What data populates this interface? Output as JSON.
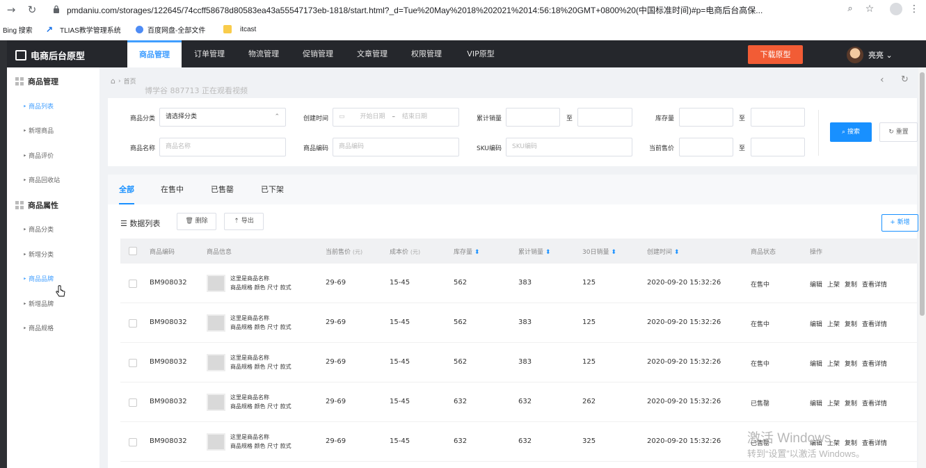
{
  "browser": {
    "url": "pmdaniu.com/storages/122645/74ccff58678d80583ea43a55547173eb-1818/start.html?_d=Tue%20May%2018%202021%2014:56:18%20GMT+0800%20(中国标准时间)#p=电商后台高保...",
    "bookmarks": [
      "Bing 搜索",
      "TLIAS教学管理系统",
      "百度网盘-全部文件",
      "itcast"
    ]
  },
  "header": {
    "brand": "电商后台原型",
    "nav": [
      "商品管理",
      "订单管理",
      "物流管理",
      "促销管理",
      "文章管理",
      "权限管理",
      "VIP原型"
    ],
    "download": "下载原型",
    "user": "亮亮"
  },
  "sidebar": {
    "group1": "商品管理",
    "group1_items": [
      "商品列表",
      "新增商品",
      "商品评价",
      "商品回收站"
    ],
    "group2": "商品属性",
    "group2_items": [
      "商品分类",
      "新增分类",
      "商品品牌",
      "新增品牌",
      "商品规格"
    ]
  },
  "breadcrumb": "首页",
  "watermark": "博学谷 887713 正在观看视频",
  "filter": {
    "category_label": "商品分类",
    "category_placeholder": "请选择分类",
    "created_label": "创建时间",
    "start_placeholder": "开始日期",
    "date_sep": "–",
    "end_placeholder": "结束日期",
    "sales_label": "累计销量",
    "to": "至",
    "stock_label": "库存量",
    "name_label": "商品名称",
    "name_placeholder": "商品名称",
    "code_label": "商品编码",
    "code_placeholder": "商品编码",
    "sku_label": "SKU编码",
    "sku_placeholder": "SKU编码",
    "price_label": "当前售价",
    "search": "搜索",
    "reset": "重置"
  },
  "tabs": [
    "全部",
    "在售中",
    "已售罄",
    "已下架"
  ],
  "list": {
    "title": "数据列表",
    "delete": "删除",
    "export": "导出",
    "add": "+ 新增"
  },
  "columns": [
    "商品编码",
    "商品信息",
    "当前售价",
    "(元)",
    "成本价",
    "(元)",
    "库存量",
    "累计销量",
    "30日销量",
    "创建时间",
    "商品状态",
    "操作"
  ],
  "rows": [
    {
      "code": "BM908032",
      "name": "这里是商品名称",
      "spec": "商品规格 颜色 尺寸 款式",
      "price": "29-69",
      "cost": "15-45",
      "stock": "562",
      "sales": "383",
      "sales30": "125",
      "created": "2020-09-20 15:32:26",
      "status": "在售中"
    },
    {
      "code": "BM908032",
      "name": "这里是商品名称",
      "spec": "商品规格 颜色 尺寸 款式",
      "price": "29-69",
      "cost": "15-45",
      "stock": "562",
      "sales": "383",
      "sales30": "125",
      "created": "2020-09-20 15:32:26",
      "status": "在售中"
    },
    {
      "code": "BM908032",
      "name": "这里是商品名称",
      "spec": "商品规格 颜色 尺寸 款式",
      "price": "29-69",
      "cost": "15-45",
      "stock": "562",
      "sales": "383",
      "sales30": "125",
      "created": "2020-09-20 15:32:26",
      "status": "在售中"
    },
    {
      "code": "BM908032",
      "name": "这里是商品名称",
      "spec": "商品规格 颜色 尺寸 款式",
      "price": "29-69",
      "cost": "15-45",
      "stock": "632",
      "sales": "632",
      "sales30": "262",
      "created": "2020-09-20 15:32:26",
      "status": "已售罄"
    },
    {
      "code": "BM908032",
      "name": "这里是商品名称",
      "spec": "商品规格 颜色 尺寸 款式",
      "price": "29-69",
      "cost": "15-45",
      "stock": "632",
      "sales": "632",
      "sales30": "325",
      "created": "2020-09-20 15:32:26",
      "status": "已售罄"
    }
  ],
  "ops": [
    "编辑",
    "上架",
    "复制",
    "查看详情"
  ],
  "windows": {
    "line1": "激活 Windows",
    "line2": "转到“设置”以激活 Windows。"
  }
}
